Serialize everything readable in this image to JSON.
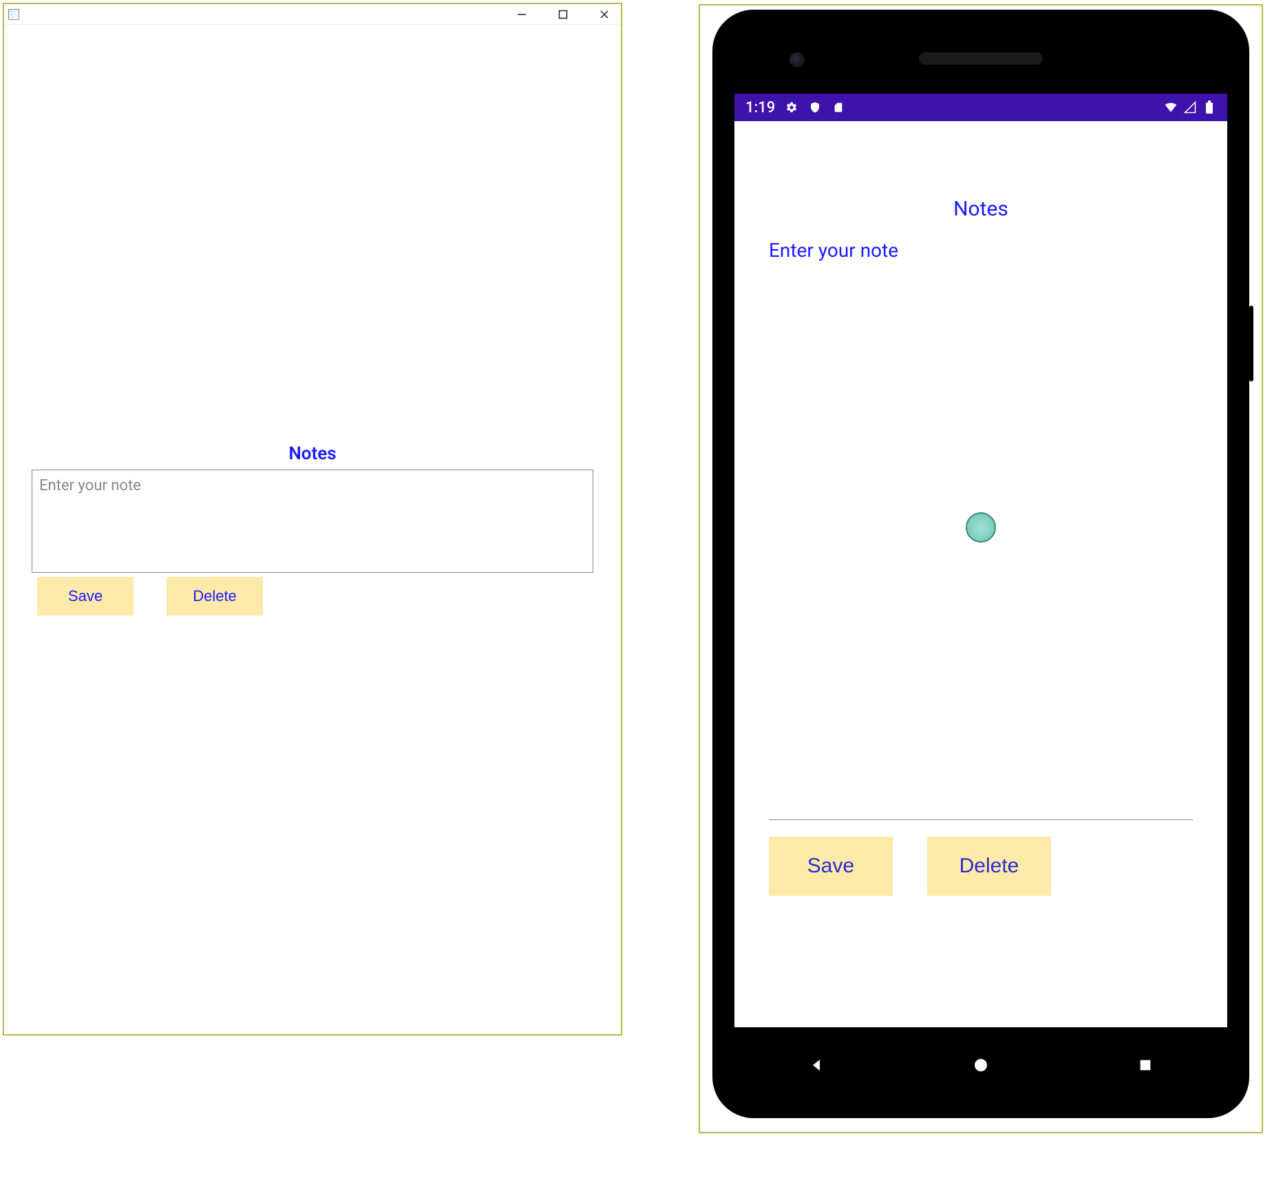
{
  "desktop": {
    "heading": "Notes",
    "placeholder": "Enter your note",
    "save_label": "Save",
    "delete_label": "Delete"
  },
  "phone": {
    "statusbar": {
      "time": "1:19",
      "accent_color": "#3f12ab"
    },
    "heading": "Notes",
    "placeholder": "Enter your note",
    "save_label": "Save",
    "delete_label": "Delete"
  },
  "colors": {
    "primary_text": "#1a1aff",
    "button_bg": "#fde9a8",
    "border_highlight": "#b8b84a"
  }
}
